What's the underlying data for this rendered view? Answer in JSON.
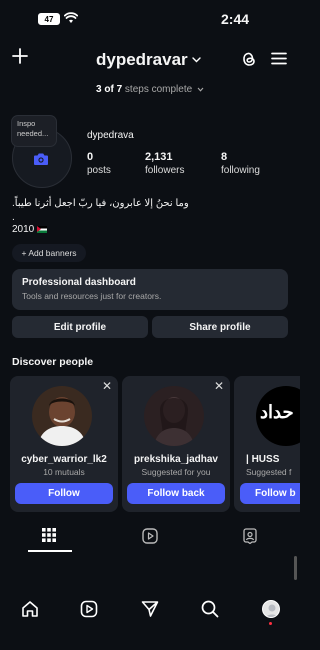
{
  "status_bar": {
    "battery": "47",
    "time": "2:44"
  },
  "header": {
    "username": "dypedravar"
  },
  "steps": {
    "progress": "3 of 7",
    "label": "steps complete"
  },
  "profile": {
    "note_bubble": "Inspo needed...",
    "handle": "dypedrava",
    "stats": [
      {
        "value": "0",
        "label": "posts"
      },
      {
        "value": "2,131",
        "label": "followers"
      },
      {
        "value": "8",
        "label": "following"
      }
    ],
    "bio_line": "وما نحنُ إلا عابرون، فيا ربّ اجعل أثرنا طيباً.",
    "bio_dot": ".",
    "bio_year": "2010"
  },
  "add_banners": "+ Add banners",
  "pro_dashboard": {
    "title": "Professional dashboard",
    "subtitle": "Tools and resources just for creators."
  },
  "buttons": {
    "edit": "Edit profile",
    "share": "Share profile"
  },
  "discover": {
    "title": "Discover people",
    "cards": [
      {
        "name": "cyber_warrior_lk2",
        "subtitle": "10 mutuals",
        "action": "Follow"
      },
      {
        "name": "prekshika_jadhav",
        "subtitle": "Suggested for you",
        "action": "Follow back"
      },
      {
        "name": "| HUSS",
        "subtitle": "Suggested f",
        "action": "Follow b",
        "logo_text": "حداد"
      }
    ]
  },
  "colors": {
    "accent": "#4a5df9",
    "background": "#0c0f14",
    "card": "#1f232b"
  }
}
